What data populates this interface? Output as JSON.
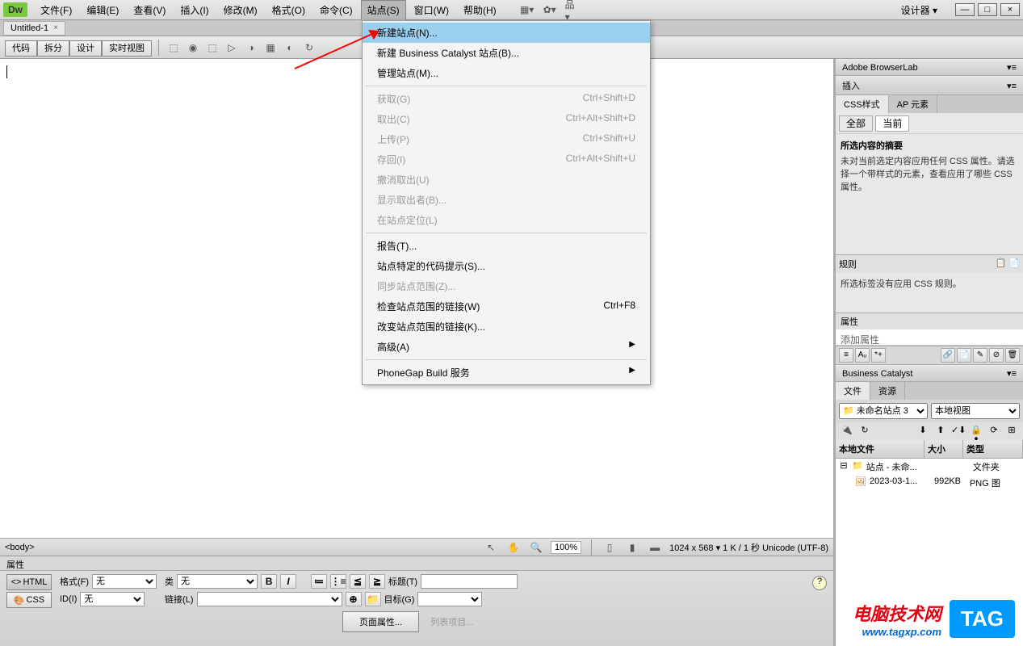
{
  "appLogo": "Dw",
  "menuBar": [
    "文件(F)",
    "编辑(E)",
    "查看(V)",
    "插入(I)",
    "修改(M)",
    "格式(O)",
    "命令(C)",
    "站点(S)",
    "窗口(W)",
    "帮助(H)"
  ],
  "designerLabel": "设计器 ▾",
  "docTab": "Untitled-1",
  "viewButtons": [
    "代码",
    "拆分",
    "设计",
    "实时视图"
  ],
  "dropdown": [
    {
      "label": "新建站点(N)...",
      "hl": true
    },
    {
      "label": "新建 Business Catalyst 站点(B)..."
    },
    {
      "label": "管理站点(M)..."
    },
    {
      "sep": true
    },
    {
      "label": "获取(G)",
      "short": "Ctrl+Shift+D",
      "dis": true
    },
    {
      "label": "取出(C)",
      "short": "Ctrl+Alt+Shift+D",
      "dis": true
    },
    {
      "label": "上传(P)",
      "short": "Ctrl+Shift+U",
      "dis": true
    },
    {
      "label": "存回(I)",
      "short": "Ctrl+Alt+Shift+U",
      "dis": true
    },
    {
      "label": "撤消取出(U)",
      "dis": true
    },
    {
      "label": "显示取出者(B)...",
      "dis": true
    },
    {
      "label": "在站点定位(L)",
      "dis": true
    },
    {
      "sep": true
    },
    {
      "label": "报告(T)..."
    },
    {
      "label": "站点特定的代码提示(S)..."
    },
    {
      "label": "同步站点范围(Z)...",
      "dis": true
    },
    {
      "label": "检查站点范围的链接(W)",
      "short": "Ctrl+F8"
    },
    {
      "label": "改变站点范围的链接(K)..."
    },
    {
      "label": "高级(A)",
      "sub": true
    },
    {
      "sep": true
    },
    {
      "label": "PhoneGap Build 服务",
      "sub": true
    }
  ],
  "statusPath": "<body>",
  "zoom": "100%",
  "statusInfo": "1024 x 568 ▾  1 K / 1 秒 Unicode (UTF-8)",
  "propsPanel": {
    "title": "属性",
    "htmlBtn": "HTML",
    "cssBtn": "CSS",
    "格式": "格式(F)",
    "格式Val": "无",
    "ID": "ID(I)",
    "IDVal": "无",
    "类": "类",
    "类Val": "无",
    "链接": "链接(L)",
    "标题": "标题(T)",
    "目标": "目标(G)",
    "pageProps": "页面属性...",
    "listItem": "列表项目..."
  },
  "panels": {
    "browserLab": "Adobe BrowserLab",
    "insert": "插入",
    "cssTab1": "CSS样式",
    "cssTab2": "AP 元素",
    "allBtn": "全部",
    "curBtn": "当前",
    "summary": "所选内容的摘要",
    "summaryText": "未对当前选定内容应用任何 CSS 属性。请选择一个带样式的元素，查看应用了哪些 CSS 属性。",
    "rules": "规则",
    "rulesText": "所选标签没有应用 CSS 规则。",
    "attrs": "属性",
    "addAttr": "添加属性",
    "bc": "Business Catalyst",
    "filesTab1": "文件",
    "filesTab2": "资源",
    "siteName": "未命名站点 3",
    "viewMode": "本地视图",
    "col1": "本地文件",
    "col2": "大小",
    "col3": "类型",
    "row1Name": "站点 - 未命...",
    "row1Type": "文件夹",
    "row2Name": "2023-03-1...",
    "row2Size": "992KB",
    "row2Type": "PNG 图"
  },
  "watermark": {
    "l1": "电脑技术网",
    "l2": "www.tagxp.com",
    "tag": "TAG"
  }
}
